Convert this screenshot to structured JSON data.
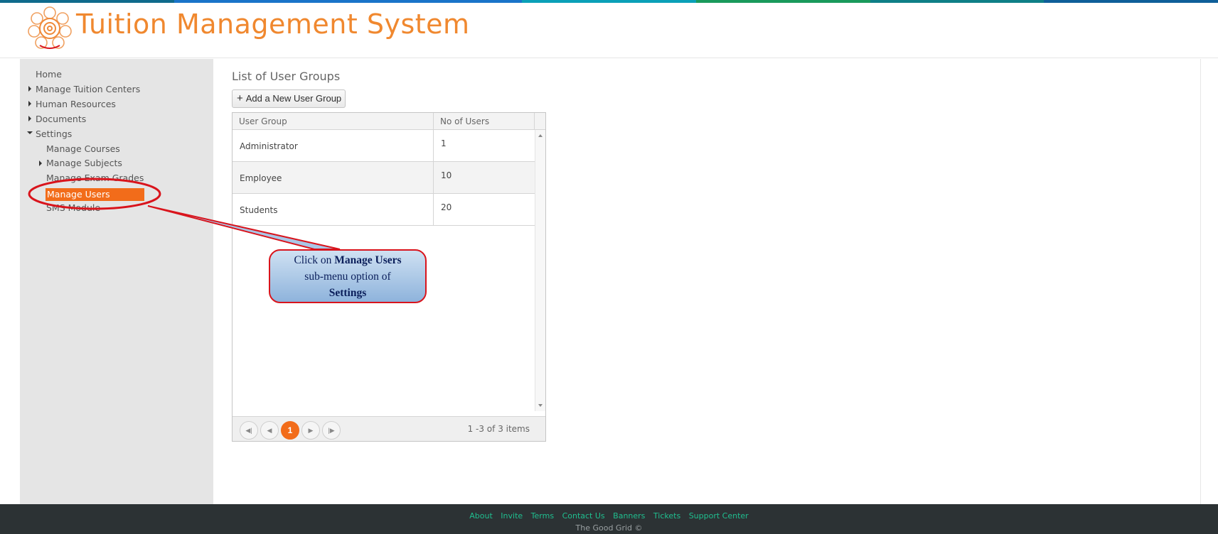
{
  "app": {
    "title": "Tuition Management System",
    "accent_color": "#f26c1a",
    "title_color": "#f0882f",
    "topbar_colors": [
      "#0f6a8c",
      "#1a74c9",
      "#1a74c9",
      "#0aa0b8",
      "#1a9a5c",
      "#0e7f87",
      "#0e5f99"
    ]
  },
  "sidebar": {
    "items": [
      {
        "label": "Home",
        "expander": "none"
      },
      {
        "label": "Manage Tuition Centers",
        "expander": "collapsed"
      },
      {
        "label": "Human Resources",
        "expander": "collapsed"
      },
      {
        "label": "Documents",
        "expander": "collapsed"
      },
      {
        "label": "Settings",
        "expander": "expanded"
      }
    ],
    "settings_children": [
      {
        "label": "Manage Courses",
        "expander": "none"
      },
      {
        "label": "Manage Subjects",
        "expander": "collapsed"
      },
      {
        "label": "Manage Exam Grades",
        "expander": "none"
      },
      {
        "label": "Manage Users",
        "expander": "none",
        "selected": true
      },
      {
        "label": "SMS Module",
        "expander": "none"
      }
    ]
  },
  "main": {
    "title": "List of User Groups",
    "add_button_label": "Add a New User Group",
    "grid": {
      "columns": [
        "User Group",
        "No of Users"
      ],
      "rows": [
        {
          "group": "Administrator",
          "users": "1"
        },
        {
          "group": "Employee",
          "users": "10"
        },
        {
          "group": "Students",
          "users": "20"
        }
      ],
      "pager": {
        "current_page": "1",
        "info": "1 -3 of 3 items"
      }
    }
  },
  "annotation": {
    "line1_prefix": "Click on ",
    "line1_bold": "Manage Users",
    "line2": "sub-menu option of",
    "line3_bold": "Settings",
    "highlight_color": "#d9141c"
  },
  "footer": {
    "links": [
      "About",
      "Invite",
      "Terms",
      "Contact Us",
      "Banners",
      "Tickets",
      "Support Center"
    ],
    "copyright": "The Good Grid ©"
  }
}
